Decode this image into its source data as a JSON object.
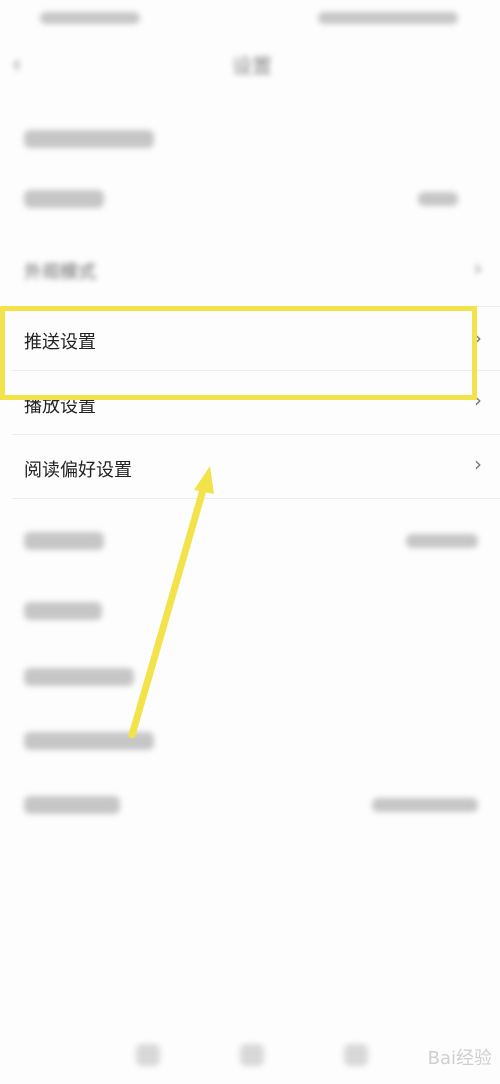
{
  "header": {
    "title": "设置"
  },
  "rows": [
    {
      "label": "外观模式"
    },
    {
      "label": "推送设置"
    },
    {
      "label": "播放设置"
    },
    {
      "label": "阅读偏好设置"
    }
  ],
  "watermark": "Bai经验",
  "colors": {
    "highlight": "#f2e34a",
    "arrow": "#f2e34a"
  },
  "icons": {
    "back": "chevron-left-icon",
    "row_arrow": "chevron-right-icon"
  }
}
